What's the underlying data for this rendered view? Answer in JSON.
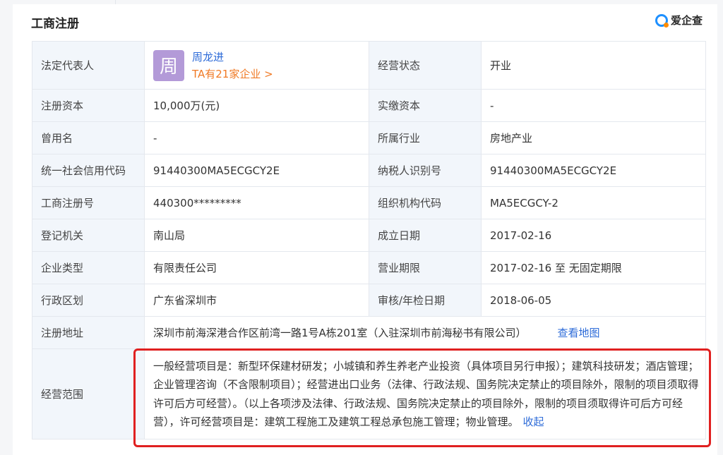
{
  "section": {
    "title": "工商注册"
  },
  "brand": {
    "name": "爱企查",
    "icon": "aiqicha-logo-icon"
  },
  "rows": [
    {
      "l1": "法定代表人",
      "l2": "经营状态",
      "v2": "开业"
    },
    {
      "l1": "注册资本",
      "v1": "10,000万(元)",
      "l2": "实缴资本",
      "v2": "-"
    },
    {
      "l1": "曾用名",
      "v1": "-",
      "l2": "所属行业",
      "v2": "房地产业"
    },
    {
      "l1": "统一社会信用代码",
      "v1": "91440300MA5ECGCY2E",
      "l2": "纳税人识别号",
      "v2": "91440300MA5ECGCY2E"
    },
    {
      "l1": "工商注册号",
      "v1": "440300*********",
      "l2": "组织机构代码",
      "v2": "MA5ECGCY-2"
    },
    {
      "l1": "登记机关",
      "v1": "南山局",
      "l2": "成立日期",
      "v2": "2017-02-16"
    },
    {
      "l1": "企业类型",
      "v1": "有限责任公司",
      "l2": "营业期限",
      "v2": "2017-02-16 至 无固定期限"
    },
    {
      "l1": "行政区划",
      "v1": "广东省深圳市",
      "l2": "审核/年检日期",
      "v2": "2018-06-05"
    }
  ],
  "representative": {
    "avatar_char": "周",
    "name": "周龙进",
    "companies": "TA有21家企业 >"
  },
  "address": {
    "label": "注册地址",
    "value": "深圳市前海深港合作区前湾一路1号A栋201室（入驻深圳市前海秘书有限公司）",
    "map_link": "查看地图"
  },
  "scope": {
    "label": "经营范围",
    "value": "一般经营项目是：新型环保建材研发；小城镇和养生养老产业投资（具体项目另行申报）；建筑科技研发；酒店管理；企业管理咨询（不含限制项目）；经营进出口业务（法律、行政法规、国务院决定禁止的项目除外，限制的项目须取得许可后方可经营）。（以上各项涉及法律、行政法规、国务院决定禁止的项目除外，限制的项目须取得许可后方可经营），许可经营项目是：建筑工程施工及建筑工程总承包施工管理；物业管理。",
    "collapse_link": "收起"
  },
  "colors": {
    "highlight": "#e02020",
    "link": "#2d6bd8",
    "accent": "#f07a25",
    "label_bg": "#f2f6fb"
  }
}
